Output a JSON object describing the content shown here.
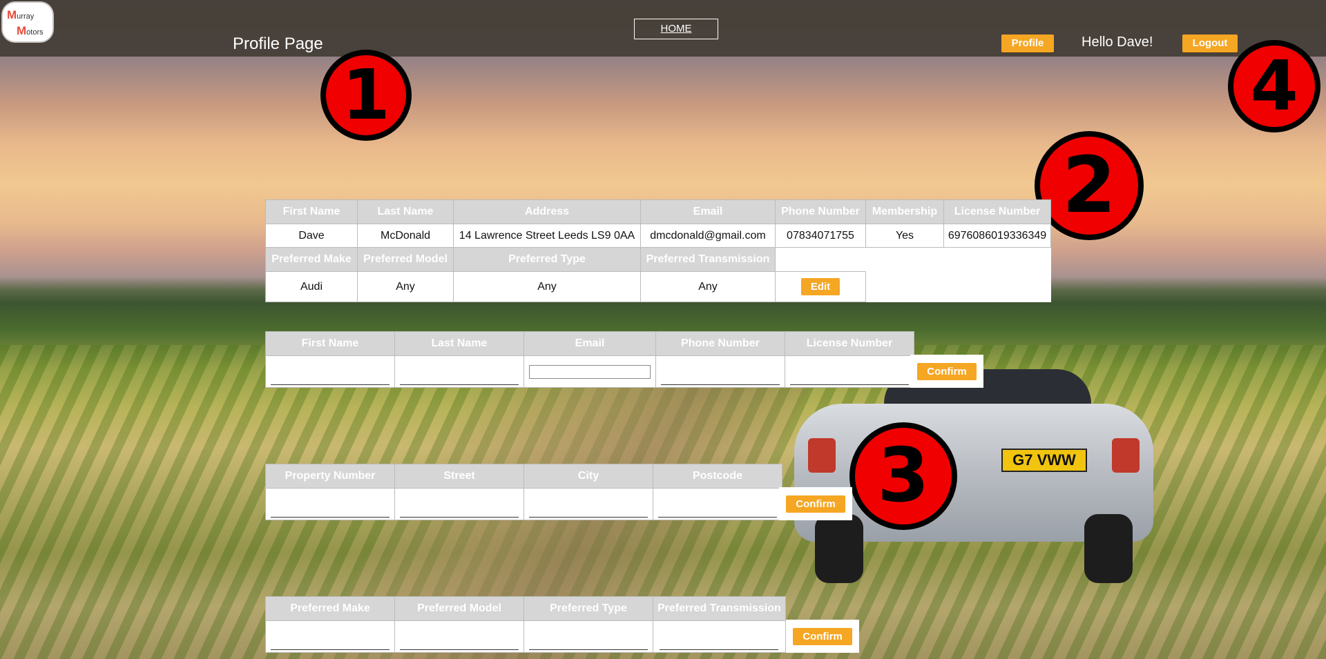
{
  "header": {
    "logo_line1_initial": "M",
    "logo_line1_rest": "urray",
    "logo_line2_initial": "M",
    "logo_line2_rest": "otors",
    "page_title": "Profile Page",
    "home_link": "HOME",
    "profile_button": "Profile",
    "greeting": "Hello Dave!",
    "logout_button": "Logout"
  },
  "markers": [
    "1",
    "2",
    "3",
    "4"
  ],
  "profile": {
    "headers": [
      "First Name",
      "Last Name",
      "Address",
      "Email",
      "Phone Number",
      "Membership",
      "License Number"
    ],
    "values": [
      "Dave",
      "McDonald",
      "14 Lawrence Street Leeds LS9 0AA",
      "dmcdonald@gmail.com",
      "07834071755",
      "Yes",
      "6976086019336349"
    ],
    "pref_headers": [
      "Preferred Make",
      "Preferred Model",
      "Preferred Type",
      "Preferred Transmission"
    ],
    "pref_values": [
      "Audi",
      "Any",
      "Any",
      "Any"
    ],
    "edit_button": "Edit"
  },
  "form_contact": {
    "headers": [
      "First Name",
      "Last Name",
      "Email",
      "Phone Number",
      "License Number"
    ],
    "confirm_button": "Confirm"
  },
  "form_address": {
    "headers": [
      "Property Number",
      "Street",
      "City",
      "Postcode"
    ],
    "confirm_button": "Confirm"
  },
  "form_preferences": {
    "headers": [
      "Preferred Make",
      "Preferred Model",
      "Preferred Type",
      "Preferred Transmission"
    ],
    "confirm_button": "Confirm"
  },
  "background": {
    "car_plate": "G7 VWW"
  },
  "colors": {
    "accent": "#f5a623",
    "topbar": "#463e37",
    "marker": "#f00000",
    "header_cell": "#d6d6d6"
  }
}
